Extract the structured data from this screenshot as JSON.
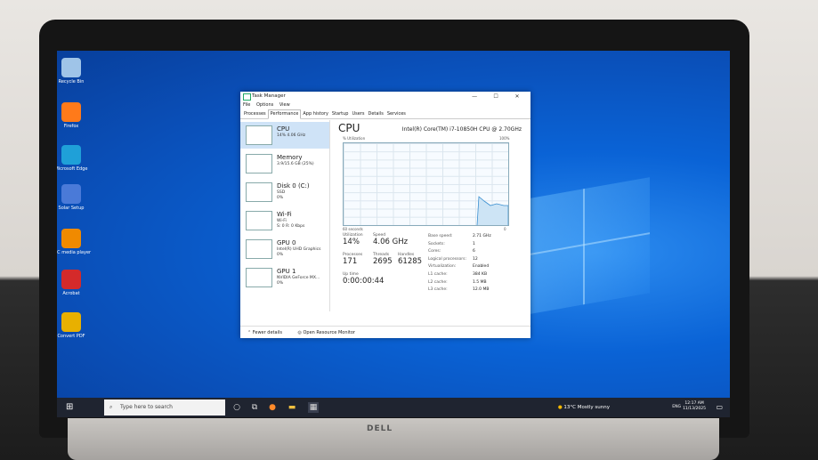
{
  "desktop": {
    "icons": [
      {
        "label": "Recycle Bin",
        "icon": "recycle-bin-icon",
        "color": "#9fc4e8"
      },
      {
        "label": "Firefox",
        "icon": "firefox-icon",
        "color": "#ff7a1a"
      },
      {
        "label": "Microsoft Edge",
        "icon": "edge-icon",
        "color": "#1fa0d8"
      },
      {
        "label": "Solar Setup",
        "icon": "setup-icon",
        "color": "#4a7ad8"
      },
      {
        "label": "VLC media player",
        "icon": "vlc-icon",
        "color": "#f08a00"
      },
      {
        "label": "Acrobat",
        "icon": "acrobat-icon",
        "color": "#d42a2a"
      },
      {
        "label": "Convert PDF",
        "icon": "pdf-icon",
        "color": "#e8b000"
      }
    ]
  },
  "task_manager": {
    "title": "Task Manager",
    "menu": [
      "File",
      "Options",
      "View"
    ],
    "tabs": [
      "Processes",
      "Performance",
      "App history",
      "Startup",
      "Users",
      "Details",
      "Services"
    ],
    "active_tab": "Performance",
    "resources": [
      {
        "name": "CPU",
        "sub": "14% 4.06 GHz"
      },
      {
        "name": "Memory",
        "sub": "3.9/15.6 GB (25%)"
      },
      {
        "name": "Disk 0 (C:)",
        "sub": "SSD\n0%"
      },
      {
        "name": "Wi-Fi",
        "sub": "Wi-Fi\nS: 0 R: 0 Kbps"
      },
      {
        "name": "GPU 0",
        "sub": "Intel(R) UHD Graphics\n0%"
      },
      {
        "name": "GPU 1",
        "sub": "NVIDIA GeForce MX...\n0%"
      }
    ],
    "cpu_title": "CPU",
    "cpu_model": "Intel(R) Core(TM) i7-10850H CPU @ 2.70GHz",
    "graph_label_left": "% Utilization",
    "graph_label_right": "100%",
    "graph_bottom_left": "60 seconds",
    "graph_bottom_right": "0",
    "stats": {
      "utilization_label": "Utilization",
      "utilization": "14%",
      "speed_label": "Speed",
      "speed": "4.06 GHz",
      "processes_label": "Processes",
      "processes": "171",
      "threads_label": "Threads",
      "threads": "2695",
      "handles_label": "Handles",
      "handles": "61285",
      "uptime_label": "Up time",
      "uptime": "0:00:00:44"
    },
    "specs": [
      [
        "Base speed:",
        "2.71 GHz"
      ],
      [
        "Sockets:",
        "1"
      ],
      [
        "Cores:",
        "6"
      ],
      [
        "Logical processors:",
        "12"
      ],
      [
        "Virtualization:",
        "Enabled"
      ],
      [
        "L1 cache:",
        "384 KB"
      ],
      [
        "L2 cache:",
        "1.5 MB"
      ],
      [
        "L3 cache:",
        "12.0 MB"
      ]
    ],
    "footer_fewer": "Fewer details",
    "footer_monitor": "Open Resource Monitor"
  },
  "taskbar": {
    "search_placeholder": "Type here to search",
    "weather": "13°C  Mostly sunny",
    "lang": "ENG",
    "time": "12:17 AM",
    "date": "11/13/2025"
  },
  "brand": "DELL"
}
